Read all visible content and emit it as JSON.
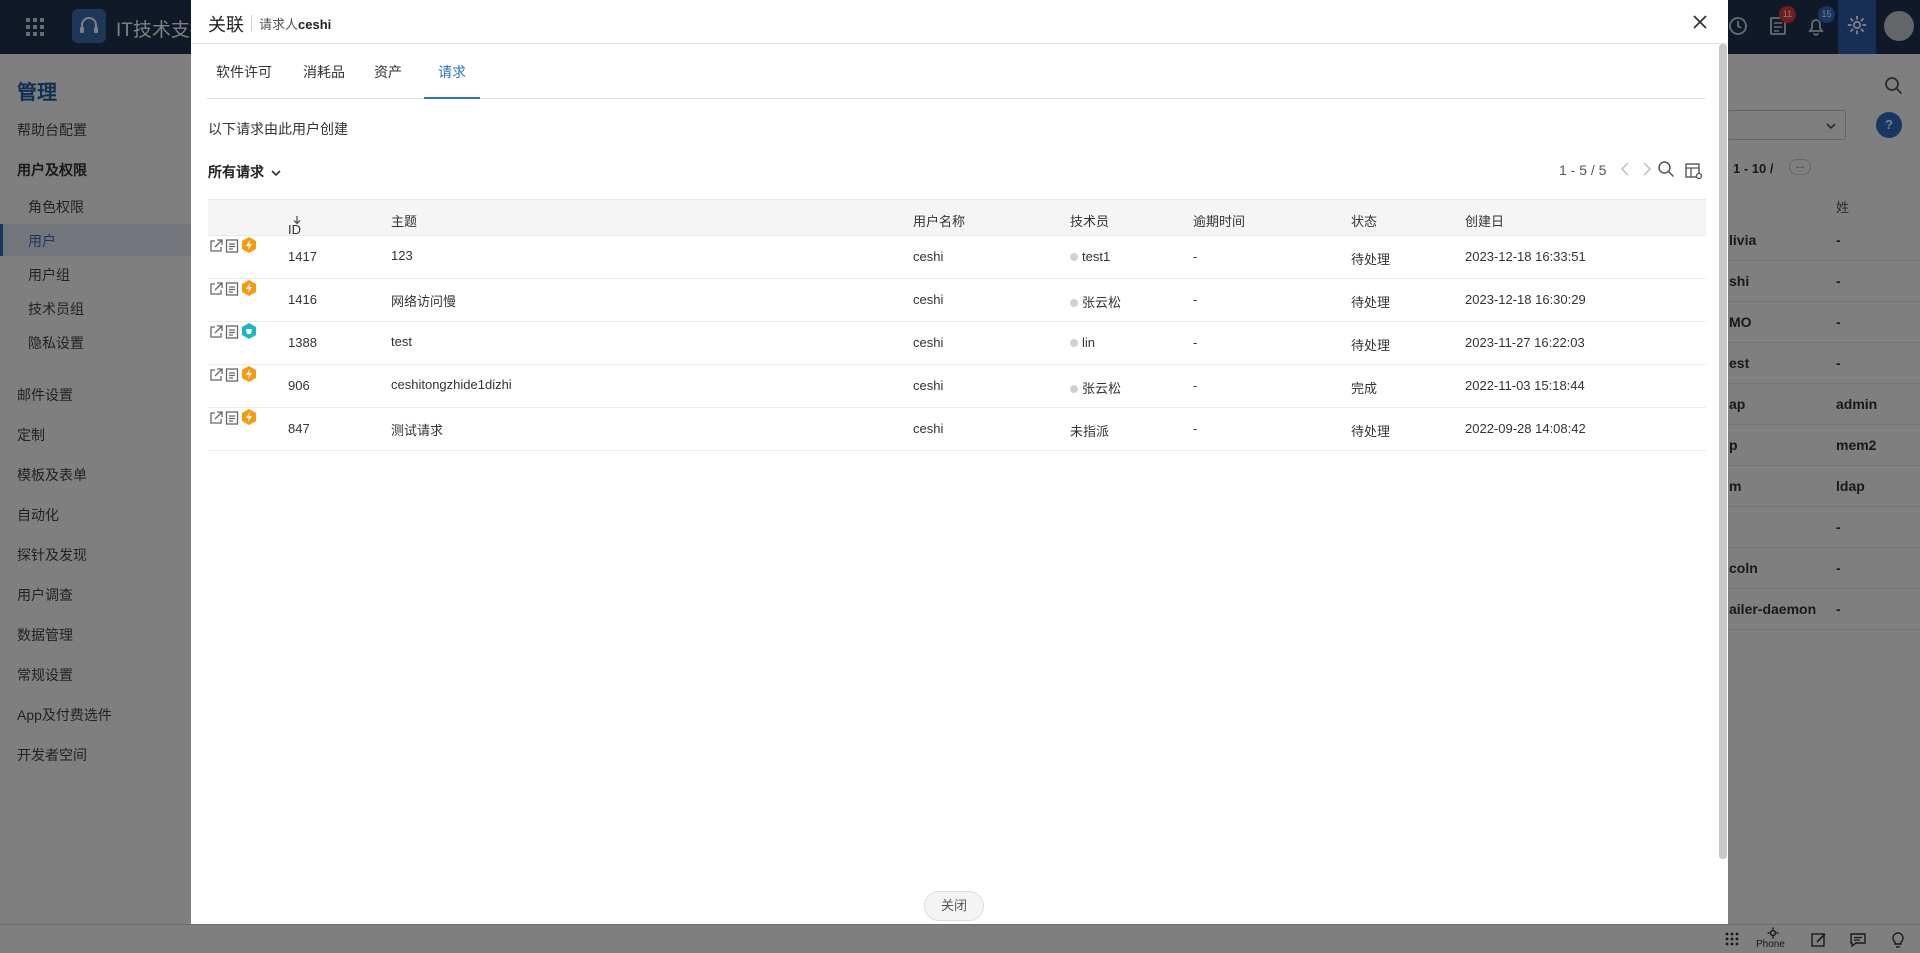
{
  "app": {
    "title": "IT技术支持",
    "badges": {
      "tasks": "11",
      "notifications": "15"
    }
  },
  "sidebar": {
    "title": "管理",
    "items": [
      {
        "label": "帮助台配置"
      },
      {
        "label": "用户及权限"
      },
      {
        "label": "角色权限"
      },
      {
        "label": "用户"
      },
      {
        "label": "用户组"
      },
      {
        "label": "技术员组"
      },
      {
        "label": "隐私设置"
      },
      {
        "label": "邮件设置"
      },
      {
        "label": "定制"
      },
      {
        "label": "模板及表单"
      },
      {
        "label": "自动化"
      },
      {
        "label": "探针及发现"
      },
      {
        "label": "用户调查"
      },
      {
        "label": "数据管理"
      },
      {
        "label": "常规设置"
      },
      {
        "label": "App及付费选件"
      },
      {
        "label": "开发者空间"
      }
    ]
  },
  "background_list": {
    "pager": "1 - 10 /",
    "more": "...",
    "header": "姓",
    "rows": [
      {
        "c1": "livia",
        "c2": "-"
      },
      {
        "c1": "shi",
        "c2": "-"
      },
      {
        "c1": "MO",
        "c2": "-"
      },
      {
        "c1": "est",
        "c2": "-"
      },
      {
        "c1": "ap",
        "c2": "admin"
      },
      {
        "c1": "p",
        "c2": "mem2"
      },
      {
        "c1": "m",
        "c2": "ldap"
      },
      {
        "c1": "",
        "c2": "-"
      },
      {
        "c1": "coln",
        "c2": "-"
      },
      {
        "c1": "ailer-daemon",
        "c2": "-"
      }
    ]
  },
  "bottom_bar": {
    "phone": "Phone"
  },
  "modal": {
    "title": "关联",
    "subtitle_prefix": "请求人",
    "subtitle_user": "ceshi",
    "tabs": [
      {
        "label": "软件许可"
      },
      {
        "label": "消耗品"
      },
      {
        "label": "资产"
      },
      {
        "label": "请求"
      }
    ],
    "active_tab": "请求",
    "intro": "以下请求由此用户创建",
    "filter_label": "所有请求",
    "pager": "1 - 5 / 5",
    "close_label": "关闭",
    "columns": {
      "id": "ID",
      "subject": "主题",
      "user": "用户名称",
      "technician": "技术员",
      "due": "逾期时间",
      "status": "状态",
      "created": "创建日"
    },
    "rows": [
      {
        "id": "1417",
        "subject": "123",
        "type": "incident",
        "user": "ceshi",
        "technician": "test1",
        "tech_dot": true,
        "due": "-",
        "status": "待处理",
        "created": "2023-12-18 16:33:51"
      },
      {
        "id": "1416",
        "subject": "网络访问慢",
        "type": "incident",
        "user": "ceshi",
        "technician": "张云松",
        "tech_dot": true,
        "due": "-",
        "status": "待处理",
        "created": "2023-12-18 16:30:29"
      },
      {
        "id": "1388",
        "subject": "test",
        "type": "service",
        "user": "ceshi",
        "technician": "lin",
        "tech_dot": true,
        "due": "-",
        "status": "待处理",
        "created": "2023-11-27 16:22:03"
      },
      {
        "id": "906",
        "subject": "ceshitongzhide1dizhi",
        "type": "incident",
        "user": "ceshi",
        "technician": "张云松",
        "tech_dot": true,
        "due": "-",
        "status": "完成",
        "created": "2022-11-03 15:18:44"
      },
      {
        "id": "847",
        "subject": "测试请求",
        "type": "incident",
        "user": "ceshi",
        "technician": "未指派",
        "tech_dot": false,
        "due": "-",
        "status": "待处理",
        "created": "2022-09-28 14:08:42"
      }
    ]
  },
  "colors": {
    "accent": "#2f6fc6",
    "topbar": "#1f3350",
    "incident": "#f39c12",
    "service": "#1fb5c4",
    "badge_red": "#e03a3a",
    "badge_blue": "#2f6fc6"
  }
}
